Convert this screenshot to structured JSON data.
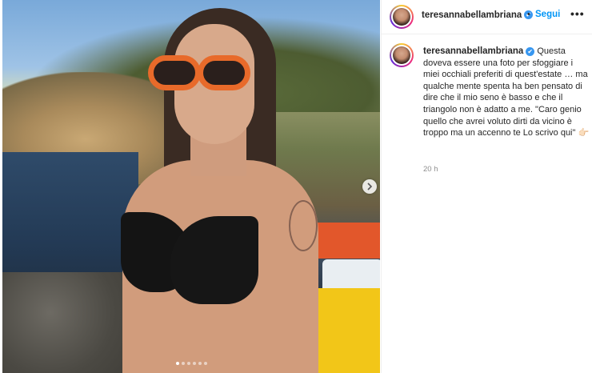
{
  "post": {
    "username": "teresannabellambriana",
    "verified_mark": "✔",
    "separator": "•",
    "follow_label": "Segui",
    "more_label": "•••",
    "caption_text": "Questa doveva essere una foto per sfoggiare i miei occhiali preferiti di quest'estate … ma qualche mente spenta ha ben pensato di dire che il mio seno è basso e che il triangolo non è adatto a me. \"Caro genio quello che avrei voluto dirti da vicino è troppo ma un accenno te Lo scrivo qui\"",
    "caption_emoji": "👉🏻",
    "time": "20 h"
  },
  "carousel": {
    "dot_count": 6,
    "active_index": 0
  },
  "colors": {
    "follow": "#0095f6",
    "verified": "#3897f0",
    "glasses": "#e86a2a"
  },
  "icons": {
    "next": "chevron-right-icon",
    "more": "more-options-icon",
    "verified": "verified-badge-icon"
  }
}
